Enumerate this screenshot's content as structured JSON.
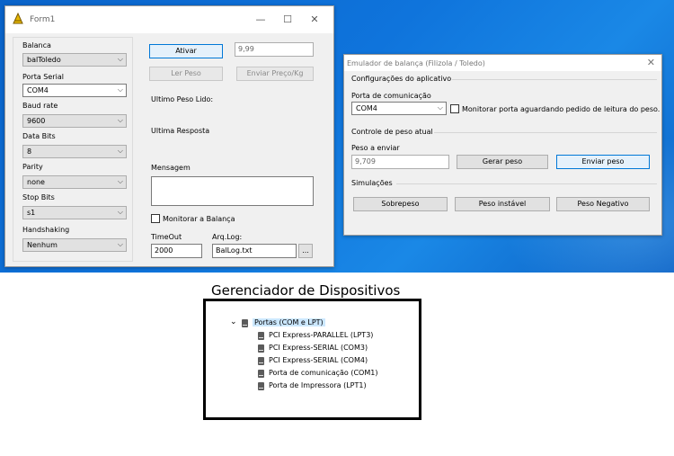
{
  "colors": {
    "desktop": "#0f74dc",
    "selection": "#cce8ff",
    "focus_border": "#0078d7"
  },
  "form1": {
    "title": "Form1",
    "controls": {
      "minimize": "—",
      "maximize": "☐",
      "close": "✕"
    },
    "balanca_label": "Balanca",
    "balanca_value": "balToledo",
    "porta_label": "Porta Serial",
    "porta_value": "COM4",
    "baud_label": "Baud rate",
    "baud_value": "9600",
    "databits_label": "Data Bits",
    "databits_value": "8",
    "parity_label": "Parity",
    "parity_value": "none",
    "stopbits_label": "Stop Bits",
    "stopbits_value": "s1",
    "handshaking_label": "Handshaking",
    "handshaking_value": "Nenhum",
    "ativar_button": "Ativar",
    "peso_field": "9,99",
    "ler_peso_button": "Ler Peso",
    "enviar_preco_button": "Enviar Preço/Kg",
    "ultimo_peso_label": "Ultimo Peso Lido:",
    "ultima_resposta_label": "Ultima Resposta",
    "mensagem_label": "Mensagem",
    "monitorar_label": "Monitorar a Balança",
    "timeout_label": "TimeOut",
    "timeout_value": "2000",
    "arqlog_label": "Arq.Log:",
    "arqlog_value": "BalLog.txt",
    "browse_button": "..."
  },
  "emulator": {
    "title": "Emulador de balança (Filizola / Toledo)",
    "close": "✕",
    "config_group": "Configurações do aplicativo",
    "porta_label": "Porta de comunicação",
    "porta_value": "COM4",
    "monitor_label": "Monitorar porta aguardando pedido de leitura do peso.",
    "controle_group": "Controle de peso atual",
    "peso_label": "Peso a enviar",
    "peso_value": "9,709",
    "gerar_button": "Gerar peso",
    "enviar_button": "Enviar peso",
    "simulacoes_group": "Simulações",
    "sobrepeso_button": "Sobrepeso",
    "instavel_button": "Peso instável",
    "negativo_button": "Peso Negativo"
  },
  "device_manager": {
    "heading": "Gerenciador de Dispositivos",
    "category": "Portas (COM e LPT)",
    "items": [
      "PCI Express-PARALLEL (LPT3)",
      "PCI Express-SERIAL (COM3)",
      "PCI Express-SERIAL (COM4)",
      "Porta de comunicação (COM1)",
      "Porta de Impressora (LPT1)"
    ]
  }
}
